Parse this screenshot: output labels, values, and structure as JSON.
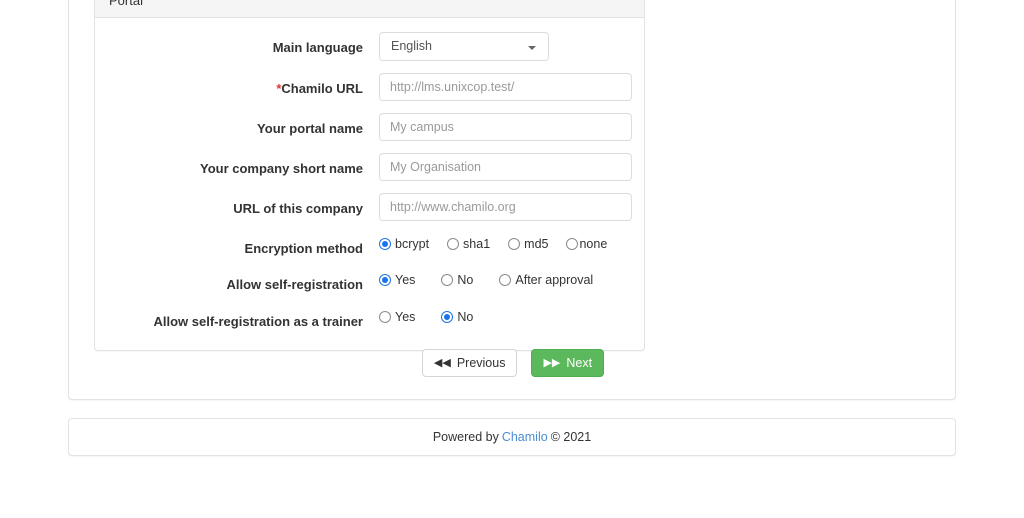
{
  "panel": {
    "heading": "Portal"
  },
  "form": {
    "rows": [
      {
        "label": "Main language",
        "required": false,
        "type": "select",
        "value": "English"
      },
      {
        "label": "Chamilo URL",
        "required": true,
        "required_mark": "*",
        "type": "text",
        "placeholder": "http://lms.unixcop.test/",
        "value": ""
      },
      {
        "label": "Your portal name",
        "required": false,
        "type": "text",
        "placeholder": "My campus",
        "value": ""
      },
      {
        "label": "Your company short name",
        "required": false,
        "type": "text",
        "placeholder": "My Organisation",
        "value": ""
      },
      {
        "label": "URL of this company",
        "required": false,
        "type": "text",
        "placeholder": "http://www.chamilo.org",
        "value": ""
      },
      {
        "label": "Encryption method",
        "required": false,
        "type": "radio",
        "options": [
          {
            "label": "bcrypt",
            "selected": true
          },
          {
            "label": "sha1",
            "selected": false
          },
          {
            "label": "md5",
            "selected": false
          },
          {
            "label": "none",
            "selected": false
          }
        ]
      },
      {
        "label": "Allow self-registration",
        "required": false,
        "type": "radio",
        "options": [
          {
            "label": "Yes",
            "selected": true
          },
          {
            "label": "No",
            "selected": false
          },
          {
            "label": "After approval",
            "selected": false
          }
        ]
      },
      {
        "label": "Allow self-registration as a trainer",
        "required": false,
        "type": "radio",
        "options": [
          {
            "label": "Yes",
            "selected": false
          },
          {
            "label": "No",
            "selected": true
          }
        ]
      }
    ]
  },
  "buttons": {
    "previous": {
      "label": "Previous",
      "icon": "double-chevron-left-icon",
      "glyph": "◀◀"
    },
    "next": {
      "label": "Next",
      "icon": "double-chevron-right-icon",
      "glyph": "▶▶"
    }
  },
  "footer": {
    "prefix": "Powered by",
    "link": "Chamilo",
    "suffix": "© 2021"
  },
  "colors": {
    "accent_radio": "#1a73e8",
    "success_button": "#5cb85c",
    "link": "#4b8dd4",
    "required_star": "#e4322b",
    "panel_heading_bg": "#f5f5f5",
    "border": "#e3e3e3"
  }
}
